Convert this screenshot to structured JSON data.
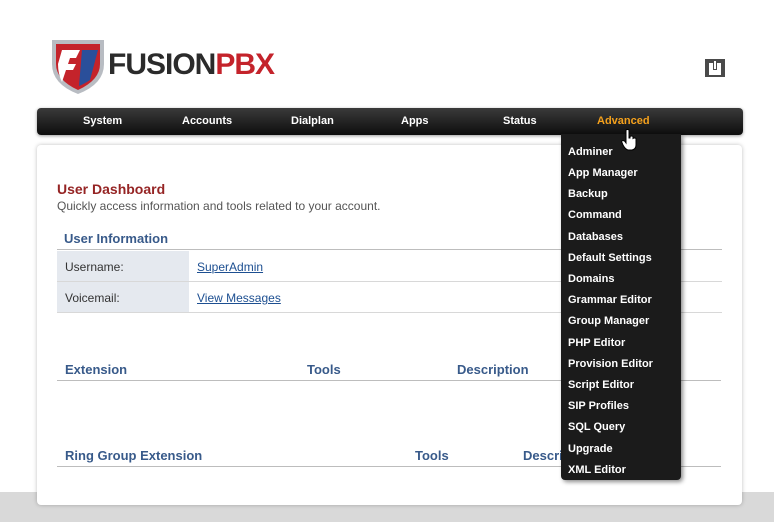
{
  "brand": {
    "name_part1": "FUSION",
    "name_part2": "PBX"
  },
  "nav": {
    "items": [
      {
        "label": "System"
      },
      {
        "label": "Accounts"
      },
      {
        "label": "Dialplan"
      },
      {
        "label": "Apps"
      },
      {
        "label": "Status"
      },
      {
        "label": "Advanced"
      }
    ],
    "active": "Advanced"
  },
  "advanced_menu": [
    "Adminer",
    "App Manager",
    "Backup",
    "Command",
    "Databases",
    "Default Settings",
    "Domains",
    "Grammar Editor",
    "Group Manager",
    "PHP Editor",
    "Provision Editor",
    "Script Editor",
    "SIP Profiles",
    "SQL Query",
    "Upgrade",
    "XML Editor"
  ],
  "page": {
    "title": "User Dashboard",
    "subtitle": "Quickly access information and tools related to your account."
  },
  "user_info": {
    "title": "User Information",
    "rows": [
      {
        "label": "Username:",
        "value": "SuperAdmin"
      },
      {
        "label": "Voicemail:",
        "value": "View Messages"
      }
    ]
  },
  "extension_table": {
    "columns": [
      "Extension",
      "Tools",
      "Description"
    ]
  },
  "ring_group_table": {
    "columns": [
      "Ring Group Extension",
      "Tools",
      "Descri"
    ]
  },
  "colors": {
    "accent": "#f5a11c",
    "title": "#952424",
    "section": "#385a8a",
    "link": "#1d4f91"
  }
}
